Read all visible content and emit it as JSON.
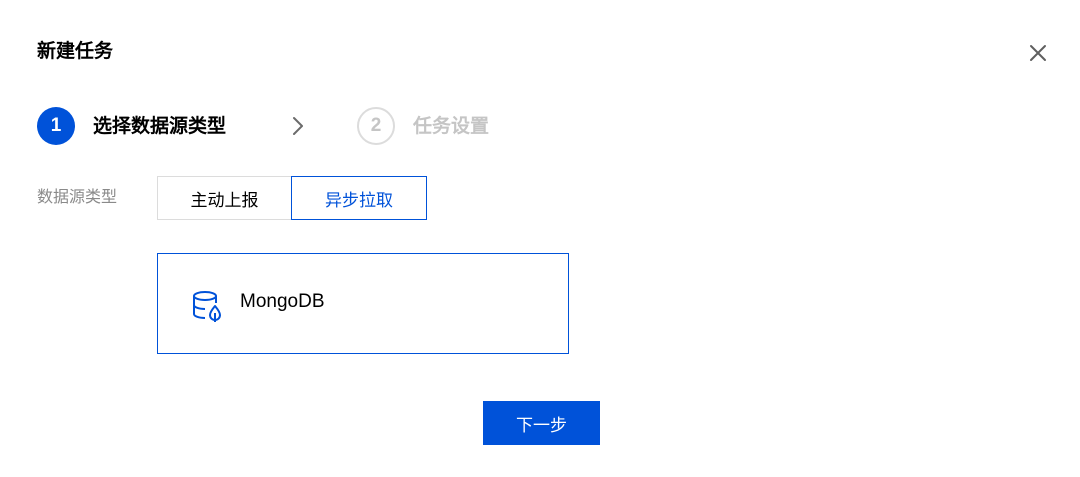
{
  "dialog": {
    "title": "新建任务",
    "close_icon": "close-icon"
  },
  "steps": [
    {
      "number": "1",
      "label": "选择数据源类型",
      "state": "active"
    },
    {
      "number": "2",
      "label": "任务设置",
      "state": "inactive"
    }
  ],
  "step_separator_icon": "chevron-right-icon",
  "source_type": {
    "label": "数据源类型",
    "options": [
      {
        "label": "主动上报",
        "selected": false
      },
      {
        "label": "异步拉取",
        "selected": true
      }
    ]
  },
  "data_sources": [
    {
      "name": "MongoDB",
      "icon": "database-icon",
      "selected": true
    }
  ],
  "footer": {
    "next_label": "下一步"
  },
  "colors": {
    "primary": "#0052d9",
    "border": "#dcdcdc",
    "muted_text": "#8a8a8a",
    "disabled_text": "#c5c5c5"
  }
}
